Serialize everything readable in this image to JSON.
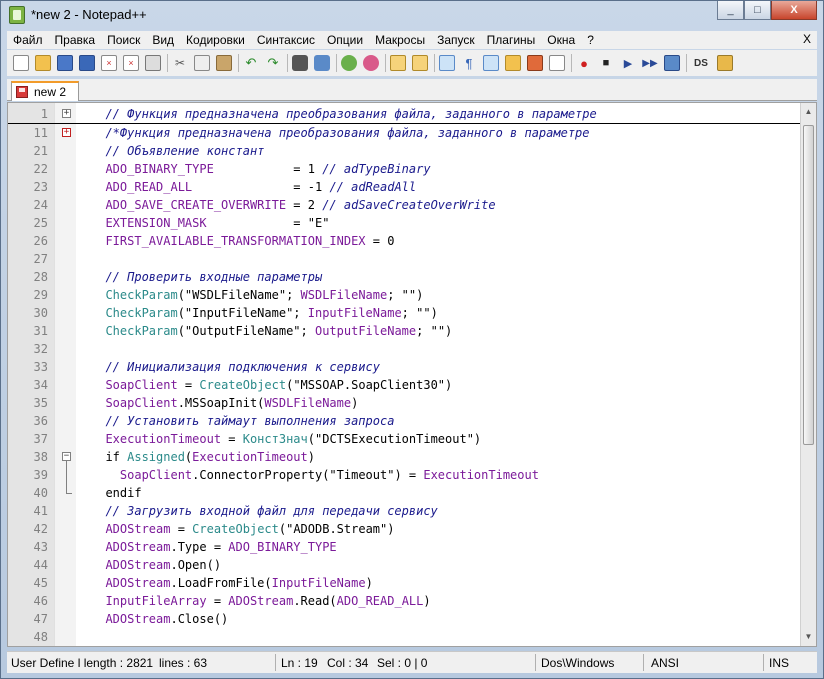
{
  "window": {
    "title": "*new  2 - Notepad++",
    "close_glyph": "X",
    "minimize_glyph": "_",
    "maximize_glyph": "□"
  },
  "menu": {
    "items": [
      "Файл",
      "Правка",
      "Поиск",
      "Вид",
      "Кодировки",
      "Синтаксис",
      "Опции",
      "Макросы",
      "Запуск",
      "Плагины",
      "Окна",
      "?"
    ],
    "close_label": "X"
  },
  "toolbar": {
    "icons": [
      "new-file",
      "open-file",
      "save",
      "save-all",
      "close",
      "close-all",
      "print",
      "cut",
      "copy",
      "paste",
      "undo",
      "redo",
      "find",
      "replace",
      "zoom-in",
      "zoom-out",
      "sync-vertical",
      "sync-horizontal",
      "word-wrap",
      "show-all-chars",
      "indent-guide",
      "user-lang",
      "doc-map",
      "function-list",
      "record-macro",
      "stop-macro",
      "play-macro",
      "run-macro-multiple",
      "save-macro",
      "ds",
      "spell"
    ],
    "ds_label": "DS"
  },
  "tab": {
    "label": "new  2"
  },
  "editor": {
    "lines": [
      {
        "n": "1",
        "fold": "+",
        "underline": true,
        "tokens": [
          [
            "  // Функция предназначена преобразования файла, заданного в параметре",
            "com"
          ]
        ]
      },
      {
        "n": "11",
        "fold": "+red",
        "underline": false,
        "tokens": [
          [
            "  /*Функция предназначена преобразования файла, заданного в параметре",
            "com"
          ]
        ]
      },
      {
        "n": "21",
        "fold": "",
        "tokens": [
          [
            "  // Объявление констант",
            "com"
          ]
        ]
      },
      {
        "n": "22",
        "fold": "",
        "tokens": [
          [
            "  ADO_BINARY_TYPE",
            "var"
          ],
          [
            "           = 1 ",
            "op"
          ],
          [
            "// adTypeBinary",
            "com"
          ]
        ]
      },
      {
        "n": "23",
        "fold": "",
        "tokens": [
          [
            "  ADO_READ_ALL",
            "var"
          ],
          [
            "              = -1 ",
            "op"
          ],
          [
            "// adReadAll",
            "com"
          ]
        ]
      },
      {
        "n": "24",
        "fold": "",
        "tokens": [
          [
            "  ADO_SAVE_CREATE_OVERWRITE",
            "var"
          ],
          [
            " = 2 ",
            "op"
          ],
          [
            "// adSaveCreateOverWrite",
            "com"
          ]
        ]
      },
      {
        "n": "25",
        "fold": "",
        "tokens": [
          [
            "  EXTENSION_MASK",
            "var"
          ],
          [
            "            = \"E\"",
            "op"
          ]
        ]
      },
      {
        "n": "26",
        "fold": "",
        "tokens": [
          [
            "  FIRST_AVAILABLE_TRANSFORMATION_INDEX",
            "var"
          ],
          [
            " = 0",
            "op"
          ]
        ]
      },
      {
        "n": "27",
        "fold": "",
        "tokens": []
      },
      {
        "n": "28",
        "fold": "",
        "tokens": [
          [
            "  // Проверить входные параметры",
            "com"
          ]
        ]
      },
      {
        "n": "29",
        "fold": "",
        "tokens": [
          [
            "  CheckParam",
            "fn"
          ],
          [
            "(\"WSDLFileName\"; ",
            "op"
          ],
          [
            "WSDLFileName",
            "var"
          ],
          [
            "; \"\")",
            "op"
          ]
        ]
      },
      {
        "n": "30",
        "fold": "",
        "tokens": [
          [
            "  CheckParam",
            "fn"
          ],
          [
            "(\"InputFileName\"; ",
            "op"
          ],
          [
            "InputFileName",
            "var"
          ],
          [
            "; \"\")",
            "op"
          ]
        ]
      },
      {
        "n": "31",
        "fold": "",
        "tokens": [
          [
            "  CheckParam",
            "fn"
          ],
          [
            "(\"OutputFileName\"; ",
            "op"
          ],
          [
            "OutputFileName",
            "var"
          ],
          [
            "; \"\")",
            "op"
          ]
        ]
      },
      {
        "n": "32",
        "fold": "",
        "tokens": []
      },
      {
        "n": "33",
        "fold": "",
        "tokens": [
          [
            "  // Инициализация подключения к сервису",
            "com"
          ]
        ]
      },
      {
        "n": "34",
        "fold": "",
        "tokens": [
          [
            "  SoapClient",
            "var"
          ],
          [
            " = ",
            "op"
          ],
          [
            "CreateObject",
            "fn"
          ],
          [
            "(\"MSSOAP.SoapClient30\")",
            "op"
          ]
        ]
      },
      {
        "n": "35",
        "fold": "",
        "tokens": [
          [
            "  SoapClient",
            "var"
          ],
          [
            ".MSSoapInit(",
            "op"
          ],
          [
            "WSDLFileName",
            "var"
          ],
          [
            ")",
            "op"
          ]
        ]
      },
      {
        "n": "36",
        "fold": "",
        "tokens": [
          [
            "  // Установить таймаут выполнения запроса",
            "com"
          ]
        ]
      },
      {
        "n": "37",
        "fold": "",
        "tokens": [
          [
            "  ExecutionTimeout",
            "var"
          ],
          [
            " = ",
            "op"
          ],
          [
            "КонстЗнач",
            "fn"
          ],
          [
            "(\"DCTSExecutionTimeout\")",
            "op"
          ]
        ]
      },
      {
        "n": "38",
        "fold": "-",
        "tokens": [
          [
            "  if ",
            "op"
          ],
          [
            "Assigned",
            "fn"
          ],
          [
            "(",
            "op"
          ],
          [
            "ExecutionTimeout",
            "var"
          ],
          [
            ")",
            "op"
          ]
        ]
      },
      {
        "n": "39",
        "fold": "line",
        "tokens": [
          [
            "    SoapClient",
            "var"
          ],
          [
            ".ConnectorProperty(\"Timeout\") = ",
            "op"
          ],
          [
            "ExecutionTimeout",
            "var"
          ]
        ]
      },
      {
        "n": "40",
        "fold": "end",
        "tokens": [
          [
            "  endif",
            "op"
          ]
        ]
      },
      {
        "n": "41",
        "fold": "",
        "tokens": [
          [
            "  // Загрузить входной файл для передачи сервису",
            "com"
          ]
        ]
      },
      {
        "n": "42",
        "fold": "",
        "tokens": [
          [
            "  ADOStream",
            "var"
          ],
          [
            " = ",
            "op"
          ],
          [
            "CreateObject",
            "fn"
          ],
          [
            "(\"ADODB.Stream\")",
            "op"
          ]
        ]
      },
      {
        "n": "43",
        "fold": "",
        "tokens": [
          [
            "  ADOStream",
            "var"
          ],
          [
            ".Type = ",
            "op"
          ],
          [
            "ADO_BINARY_TYPE",
            "var"
          ]
        ]
      },
      {
        "n": "44",
        "fold": "",
        "tokens": [
          [
            "  ADOStream",
            "var"
          ],
          [
            ".Open()",
            "op"
          ]
        ]
      },
      {
        "n": "45",
        "fold": "",
        "tokens": [
          [
            "  ADOStream",
            "var"
          ],
          [
            ".LoadFromFile(",
            "op"
          ],
          [
            "InputFileName",
            "var"
          ],
          [
            ")",
            "op"
          ]
        ]
      },
      {
        "n": "46",
        "fold": "",
        "tokens": [
          [
            "  InputFileArray",
            "var"
          ],
          [
            " = ",
            "op"
          ],
          [
            "ADOStream",
            "var"
          ],
          [
            ".Read(",
            "op"
          ],
          [
            "ADO_READ_ALL",
            "var"
          ],
          [
            ")",
            "op"
          ]
        ]
      },
      {
        "n": "47",
        "fold": "",
        "tokens": [
          [
            "  ADOStream",
            "var"
          ],
          [
            ".Close()",
            "op"
          ]
        ]
      },
      {
        "n": "48",
        "fold": "",
        "tokens": []
      }
    ]
  },
  "status": {
    "lang_length": "User Define l length : 2821",
    "lines": "lines : 63",
    "pos": "Ln : 19",
    "col": "Col : 34",
    "sel": "Sel : 0 | 0",
    "eol": "Dos\\Windows",
    "encoding": "ANSI",
    "mode": "INS"
  },
  "colors": {
    "comment": "#1a1a8c",
    "variable": "#7b1a99",
    "function": "#2b8a8a",
    "tab_accent": "#f29b2a"
  }
}
